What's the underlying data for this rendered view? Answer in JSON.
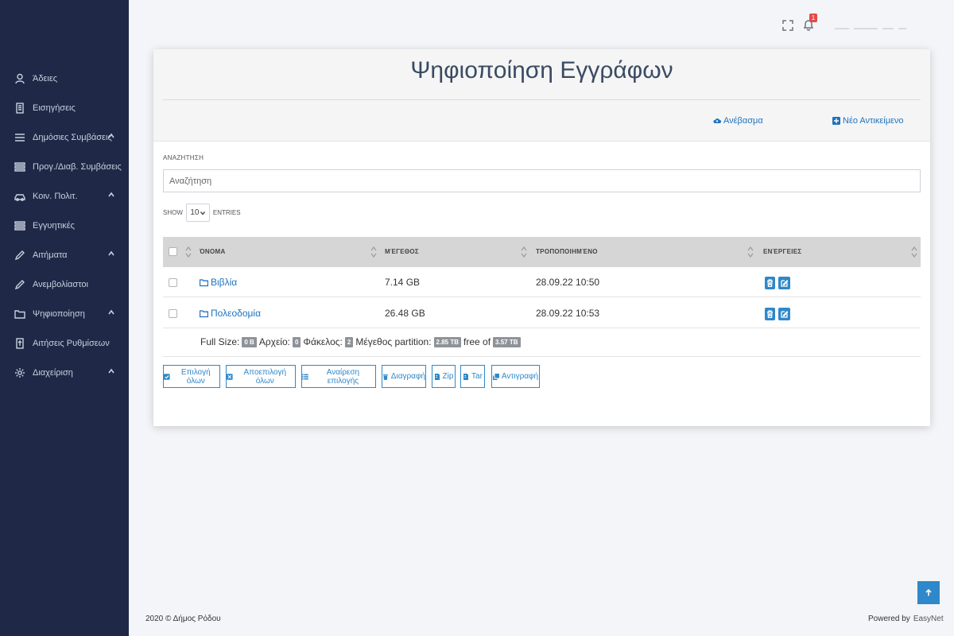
{
  "sidebar": {
    "items": [
      {
        "label": "Άδειες",
        "icon": "user-icon"
      },
      {
        "label": "Εισηγήσεις",
        "icon": "document-icon"
      },
      {
        "label": "Δημόσιες Συμβάσεις",
        "icon": "menu-icon",
        "expandable": true
      },
      {
        "label": "Προγ./Διαβ. Συμβάσεις",
        "icon": "list-icon"
      },
      {
        "label": "Κοιν. Πολιτ.",
        "icon": "car-icon",
        "expandable": true
      },
      {
        "label": "Εγγυητικές",
        "icon": "list-icon"
      },
      {
        "label": "Αιτήματα",
        "icon": "pencil-icon",
        "expandable": true
      },
      {
        "label": "Ανεμβολίαστοι",
        "icon": "pencil-icon"
      },
      {
        "label": "Ψηφιοποίηση",
        "icon": "folder-icon",
        "expandable": true
      },
      {
        "label": "Αιτήσεις Ρυθμίσεων",
        "icon": "upload-file-icon"
      },
      {
        "label": "Διαχείριση",
        "icon": "gear-icon",
        "expandable": true
      }
    ]
  },
  "topbar": {
    "notification_count": "1"
  },
  "card": {
    "title": "Ψηφιοποίηση Εγγράφων",
    "upload_label": "Ανέβασμα",
    "new_item_label": "Νέο Αντικείμενο"
  },
  "search": {
    "label": "ΑΝΑΖΗΤΗΣΗ",
    "placeholder": "Αναζήτηση"
  },
  "length": {
    "show": "SHOW",
    "value": "10",
    "entries": "ENTRIES"
  },
  "table": {
    "headers": {
      "name": "ΌΝΟΜΑ",
      "size": "ΜΈΓΕΘΟΣ",
      "modified": "ΤΡΟΠΟΠΟΙΗΜΈΝΟ",
      "actions": "ΕΝΈΡΓΕΙΕΣ"
    },
    "rows": [
      {
        "name": "Βιβλία",
        "size": "7.14 GB",
        "modified": "28.09.22 10:50"
      },
      {
        "name": "Πολεοδομία",
        "size": "26.48 GB",
        "modified": "28.09.22 10:53"
      }
    ]
  },
  "summary": {
    "full_size_label": "Full Size:",
    "full_size": "0 B",
    "file_label": "Αρχείο:",
    "file_count": "0",
    "folder_label": "Φάκελος:",
    "folder_count": "2",
    "partition_label": "Μέγεθος partition:",
    "partition": "2.85 TB",
    "free_label": "free of",
    "total": "3.57 TB"
  },
  "actions": {
    "select_all": "Επιλογή όλων",
    "deselect_all": "Αποεπιλογή όλων",
    "invert": "Αναίρεση επιλογής",
    "delete": "Διαγραφή",
    "zip": "Zip",
    "tar": "Tar",
    "copy": "Αντιγραφή"
  },
  "footer": {
    "copyright": "2020 © Δήμος Ρόδου",
    "powered_by": "Powered by",
    "brand": "EasyNet"
  },
  "colors": {
    "sidebar_bg": "#1f2947",
    "accent": "#2f88c9",
    "badge": "#e24b4b"
  }
}
